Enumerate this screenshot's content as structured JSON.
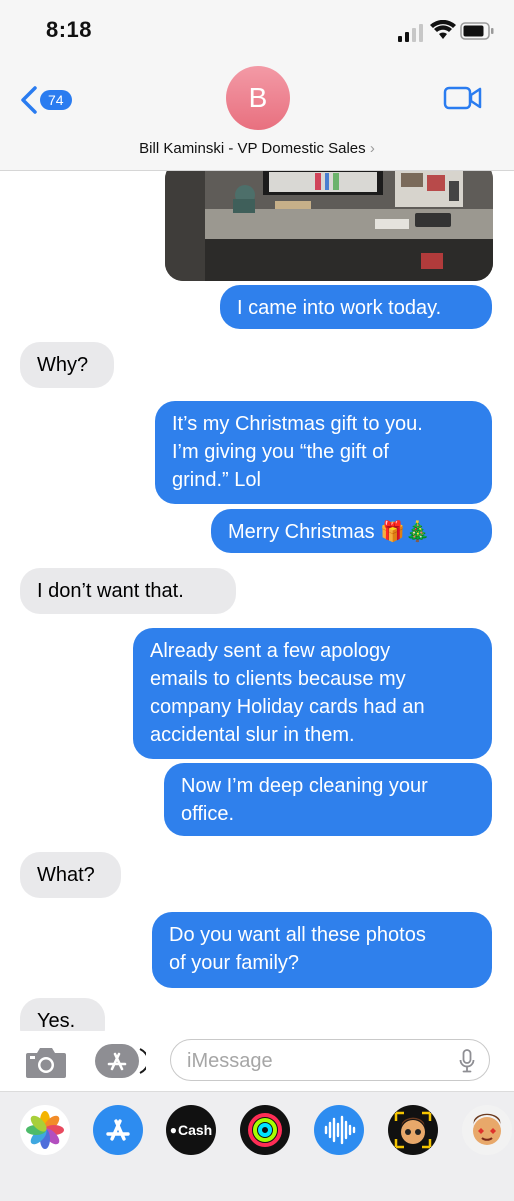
{
  "status": {
    "time": "8:18"
  },
  "nav": {
    "back_count": "74",
    "avatar_initial": "B",
    "contact_name": "Bill Kaminski  - VP Domestic Sales",
    "contact_chevron": "›"
  },
  "messages": [
    {
      "from": "me",
      "text": "I came into work today."
    },
    {
      "from": "them",
      "text": "Why?"
    },
    {
      "from": "me",
      "text": "It’s my Christmas gift to you.\nI’m giving you “the gift of\ngrind.” Lol"
    },
    {
      "from": "me",
      "text": "Merry Christmas 🎁🎄"
    },
    {
      "from": "them",
      "text": "I don’t want that."
    },
    {
      "from": "me",
      "text": "Already sent a few apology\nemails to clients because my\ncompany Holiday cards had an\naccidental slur in them."
    },
    {
      "from": "me",
      "text": "Now I’m deep cleaning your\noffice."
    },
    {
      "from": "them",
      "text": "What?"
    },
    {
      "from": "me",
      "text": "Do you want all these photos\nof your family?"
    },
    {
      "from": "them",
      "text": "Yes."
    }
  ],
  "composer": {
    "placeholder": "iMessage"
  },
  "app_strip": {
    "cash_label": "Cash"
  },
  "colors": {
    "outgoing": "#2f80ec",
    "incoming": "#e9e9eb",
    "accent": "#2a7cf0"
  }
}
